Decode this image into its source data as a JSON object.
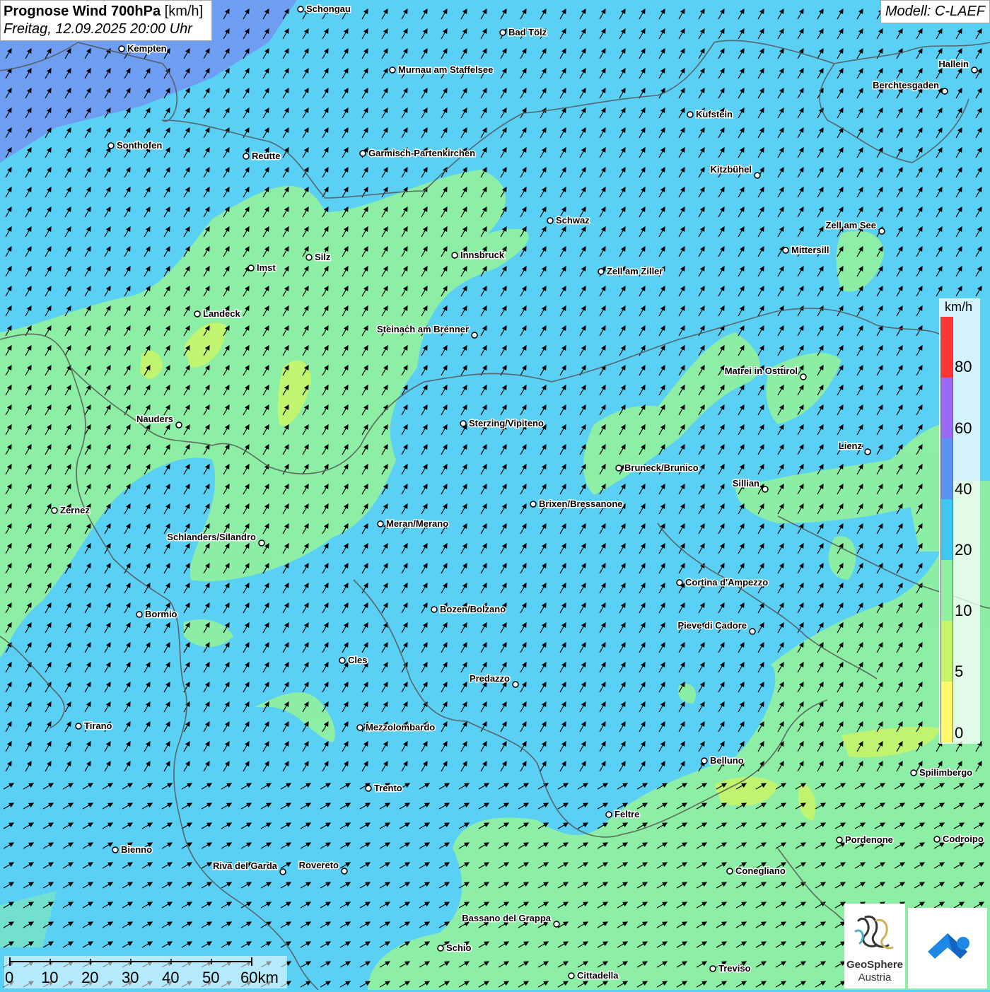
{
  "header": {
    "title_bold": "Prognose Wind 700hPa",
    "title_unit": " [km/h]",
    "datetime": "Freitag, 12.09.2025 20:00 Uhr",
    "model": "Modell: C-LAEF"
  },
  "legend": {
    "unit": "km/h",
    "labels": [
      "80",
      "60",
      "40",
      "20",
      "10",
      "5",
      "0"
    ],
    "colors": [
      "#ff3535",
      "#9b6af5",
      "#5b93f5",
      "#3cc8f0",
      "#8ff0a0",
      "#c6f56a",
      "#fff86a"
    ]
  },
  "scale": {
    "labels": [
      "0",
      "10",
      "20",
      "30",
      "40",
      "50",
      "60km"
    ]
  },
  "logos": {
    "geosphere_line1": "GeoSphere",
    "geosphere_line2": "Austria"
  },
  "cities": [
    {
      "name": "Schongau"
    },
    {
      "name": "Bad Tölz"
    },
    {
      "name": "Kempten"
    },
    {
      "name": "Murnau am Staffelsee"
    },
    {
      "name": "Hallein"
    },
    {
      "name": "Berchtesgaden"
    },
    {
      "name": "Kufstein"
    },
    {
      "name": "Sonthofen"
    },
    {
      "name": "Reutte"
    },
    {
      "name": "Garmisch-Partenkirchen"
    },
    {
      "name": "Kitzbühel"
    },
    {
      "name": "Schwaz"
    },
    {
      "name": "Zell am See"
    },
    {
      "name": "Mittersill"
    },
    {
      "name": "Imst"
    },
    {
      "name": "Silz"
    },
    {
      "name": "Innsbruck"
    },
    {
      "name": "Zell am Ziller"
    },
    {
      "name": "Landeck"
    },
    {
      "name": "Steinach am Brenner"
    },
    {
      "name": "Matrei in Osttirol"
    },
    {
      "name": "Nauders"
    },
    {
      "name": "Sterzing/Vipiteno"
    },
    {
      "name": "Lienz"
    },
    {
      "name": "Bruneck/Brunico"
    },
    {
      "name": "Sillian"
    },
    {
      "name": "Zernez"
    },
    {
      "name": "Brixen/Bressanone"
    },
    {
      "name": "Meran/Merano"
    },
    {
      "name": "Schlanders/Silandro"
    },
    {
      "name": "Cortina d'Ampezzo"
    },
    {
      "name": "Bozen/Bolzano"
    },
    {
      "name": "Bormio"
    },
    {
      "name": "Pieve di Cadore"
    },
    {
      "name": "Cles"
    },
    {
      "name": "Predazzo"
    },
    {
      "name": "Tirano"
    },
    {
      "name": "Mezzolombardo"
    },
    {
      "name": "Belluno"
    },
    {
      "name": "Spilimbergo"
    },
    {
      "name": "Trento"
    },
    {
      "name": "Feltre"
    },
    {
      "name": "Pordenone"
    },
    {
      "name": "Codroipo"
    },
    {
      "name": "Bienno"
    },
    {
      "name": "Riva del Garda"
    },
    {
      "name": "Rovereto"
    },
    {
      "name": "Conegliano"
    },
    {
      "name": "Bassano del Grappa"
    },
    {
      "name": "Schio"
    },
    {
      "name": "Treviso"
    },
    {
      "name": "Cittadella"
    }
  ],
  "colors": {
    "wind_5_10": "#c6f56a",
    "wind_10_20": "#8ff0a0",
    "wind_20_40": "#5ad0f5",
    "wind_40_60": "#5b93f5"
  }
}
